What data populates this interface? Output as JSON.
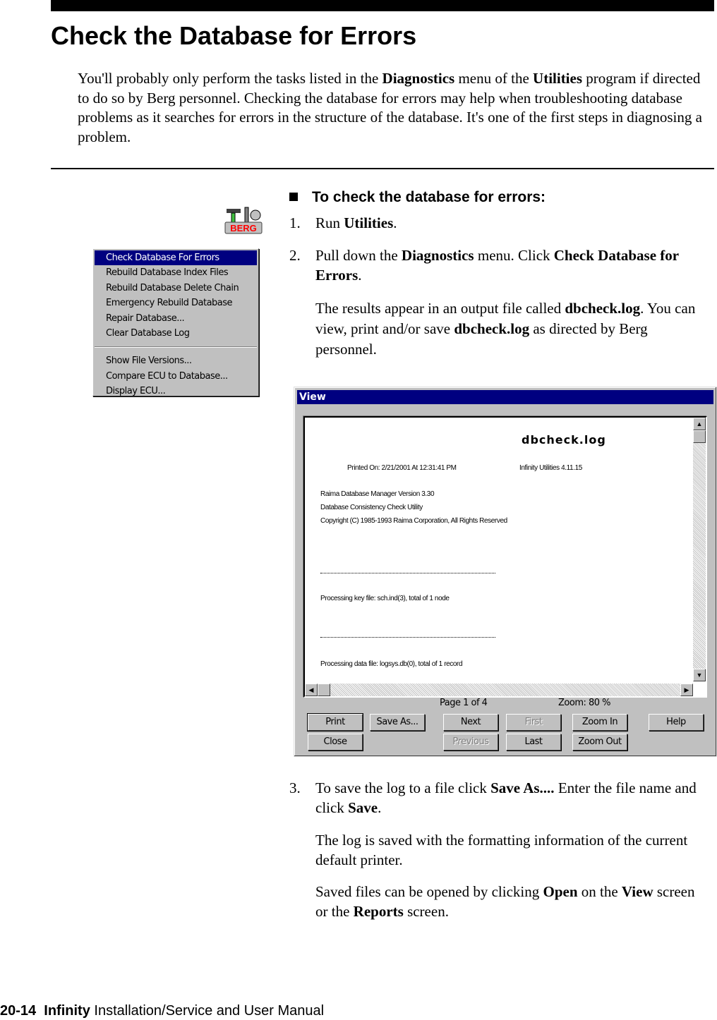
{
  "title": "Check the Database for Errors",
  "intro": [
    {
      "t": "You'll probably only perform the tasks listed in the "
    },
    {
      "t": "Diagnostics",
      "b": 1
    },
    {
      "t": " menu of the "
    },
    {
      "t": "Utilities",
      "b": 1
    },
    {
      "t": " program if directed to do so by Berg personnel. Checking the database for errors may help when troubleshooting database problems as it searches for errors in the structure of the database. It's one of the first steps in diagnosing a problem."
    }
  ],
  "procedure_heading": "To check the database for errors:",
  "steps": [
    {
      "num": "1.",
      "runs": [
        {
          "t": "Run "
        },
        {
          "t": "Utilities",
          "b": 1
        },
        {
          "t": "."
        }
      ]
    },
    {
      "num": "2.",
      "runs": [
        {
          "t": "Pull down the "
        },
        {
          "t": "Diagnostics",
          "b": 1
        },
        {
          "t": " menu. Click "
        },
        {
          "t": "Check Database for Errors",
          "b": 1
        },
        {
          "t": "."
        }
      ]
    },
    {
      "num": "3.",
      "runs": [
        {
          "t": "To save the log to a file click "
        },
        {
          "t": "Save As....",
          "b": 1
        },
        {
          "t": " Enter the file name and click "
        },
        {
          "t": "Save",
          "b": 1
        },
        {
          "t": "."
        }
      ]
    }
  ],
  "notes": [
    [
      {
        "t": "The results appear in  an output file called "
      },
      {
        "t": "dbcheck.log",
        "b": 1
      },
      {
        "t": ". You can view, print and/or save "
      },
      {
        "t": "dbcheck.log",
        "b": 1
      },
      {
        "t": " as directed by Berg personnel."
      }
    ],
    [
      {
        "t": "The log is saved with the formatting information of the current default printer."
      }
    ],
    [
      {
        "t": "Saved files can be opened by clicking "
      },
      {
        "t": "Open",
        "b": 1
      },
      {
        "t": " on the "
      },
      {
        "t": "View",
        "b": 1
      },
      {
        "t": " screen or the "
      },
      {
        "t": "Reports",
        "b": 1
      },
      {
        "t": " screen."
      }
    ]
  ],
  "logo": {
    "text": "BERG",
    "icon": "berg-utilities-icon"
  },
  "menu": {
    "group1": [
      "Check Database For Errors",
      "Rebuild Database Index Files",
      "Rebuild Database Delete Chain",
      "Emergency Rebuild Database",
      "Repair Database...",
      "Clear Database Log"
    ],
    "group2": [
      "Show File Versions...",
      "Compare ECU to Database...",
      "Display ECU..."
    ],
    "selected": "Check Database For Errors"
  },
  "view": {
    "title": "View",
    "log_title": "dbcheck.log",
    "printed_on": "Printed On: 2/21/2001 At 12:31:41 PM",
    "app_version": "Infinity Utilities 4.11.15",
    "lines": [
      "Raima Database Manager Version 3.30",
      "Database Consistency Check Utility",
      "Copyright (C) 1985-1993 Raima Corporation, All Rights Reserved"
    ],
    "key_file": "Processing key file: sch.ind(3), total of 1 node",
    "data_file": "Processing data file: logsys.db(0), total of 1 record",
    "page_status": "Page 1 of 4",
    "zoom_status": "Zoom: 80 %",
    "buttons": {
      "print": "Print",
      "save_as": "Save As...",
      "next": "Next",
      "first": "First",
      "zoom_in": "Zoom In",
      "help": "Help",
      "close": "Close",
      "previous": "Previous",
      "last": "Last",
      "zoom_out": "Zoom Out"
    }
  },
  "footer": {
    "page": "20-14",
    "product": "Infinity",
    "rest": "Installation/Service and User Manual"
  }
}
